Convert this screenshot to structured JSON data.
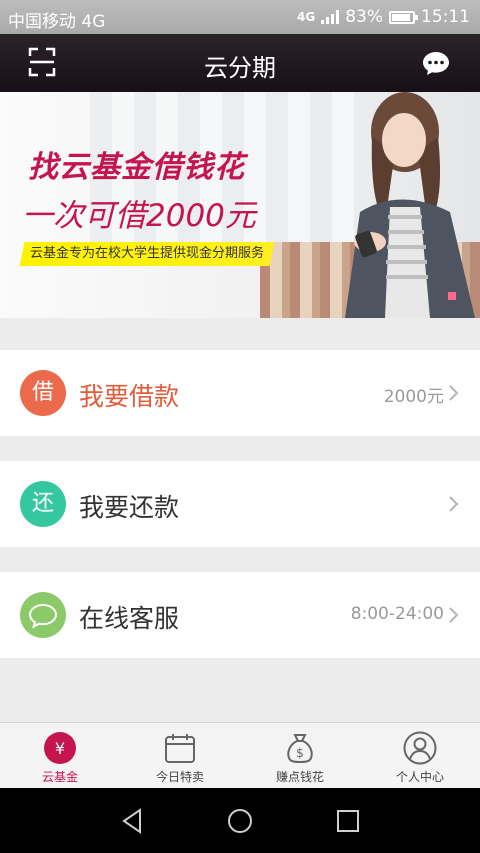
{
  "status_bar": {
    "carrier": "中国移动 4G",
    "network_badge": "4G",
    "battery": "83%",
    "time": "15:11"
  },
  "header": {
    "title": "云分期",
    "left_icon": "scan-icon",
    "right_icon": "chat-bubble-icon"
  },
  "banner": {
    "headline": "找云基金借钱花",
    "subline": "一次可借2000元",
    "tagline": "云基金专为在校大学生提供现金分期服务"
  },
  "menu": [
    {
      "icon_text": "借",
      "icon_color": "#ec6a4c",
      "label": "我要借款",
      "label_color": "#e25c3c",
      "value": "2000元"
    },
    {
      "icon_text": "还",
      "icon_color": "#35c7a0",
      "label": "我要还款",
      "label_color": "#333333",
      "value": ""
    },
    {
      "icon_text": "",
      "icon_color": "#8cc968",
      "label": "在线客服",
      "label_color": "#333333",
      "value": "8:00-24:00"
    }
  ],
  "tabs": [
    {
      "label": "云基金",
      "icon": "yen-coin-icon",
      "active": true
    },
    {
      "label": "今日特卖",
      "icon": "calendar-icon",
      "active": false
    },
    {
      "label": "赚点钱花",
      "icon": "money-bag-icon",
      "active": false
    },
    {
      "label": "个人中心",
      "icon": "user-profile-icon",
      "active": false
    }
  ],
  "colors": {
    "accent": "#c4154e",
    "header_bg": "#1f161c",
    "page_bg": "#ececec"
  }
}
